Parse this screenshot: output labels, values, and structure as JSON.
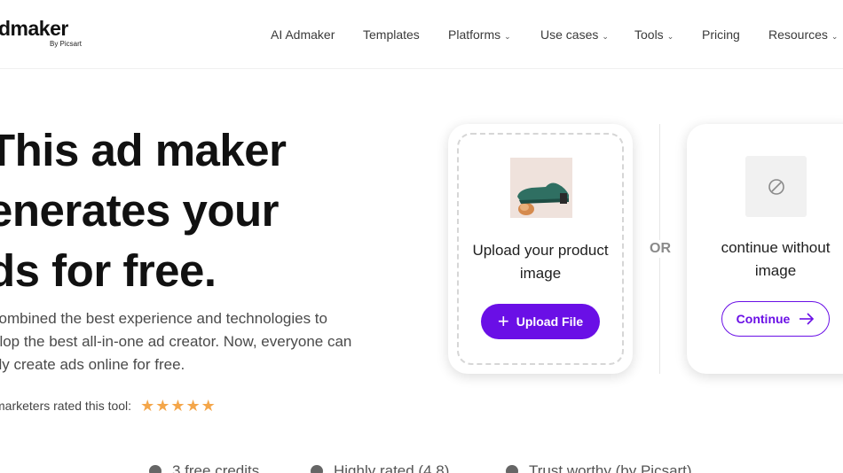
{
  "brand": {
    "name": "dmaker",
    "sub": "By Picsart"
  },
  "nav": {
    "items": [
      {
        "label": "AI Admaker",
        "dropdown": false
      },
      {
        "label": "Templates",
        "dropdown": false
      },
      {
        "label": "Platforms",
        "dropdown": true
      },
      {
        "label": "Use cases",
        "dropdown": true
      },
      {
        "label": "Tools",
        "dropdown": true
      },
      {
        "label": "Pricing",
        "dropdown": false
      },
      {
        "label": "Resources",
        "dropdown": true
      }
    ]
  },
  "hero": {
    "title_lines": [
      "This ad maker",
      "enerates your",
      "ds for free."
    ],
    "description_lines": [
      "combined the best experience and technologies to",
      "elop the best all-in-one ad creator. Now, everyone can",
      "kly create ads online for free."
    ],
    "rating_label": "marketers rated this tool:",
    "rating_stars": 5
  },
  "upload_card": {
    "title": "Upload your product image",
    "button_label": "Upload File",
    "image_icon": "shoe-product-image"
  },
  "separator": {
    "label": "OR"
  },
  "continue_card": {
    "title": "continue without image",
    "button_label": "Continue",
    "icon": "no-image-icon"
  },
  "features": [
    {
      "label": "3 free credits",
      "icon": "credit-icon"
    },
    {
      "label": "Highly rated (4.8)",
      "icon": "rating-icon"
    },
    {
      "label": "Trust worthy (by Picsart)",
      "icon": "shield-icon"
    }
  ],
  "colors": {
    "accent": "#6a0fe6",
    "star": "#f4a64a"
  }
}
